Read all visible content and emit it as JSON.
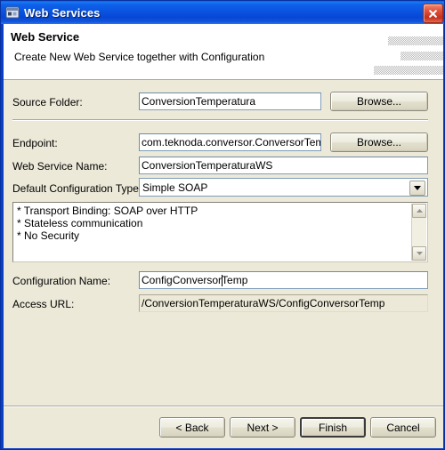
{
  "window": {
    "title": "Web Services",
    "icon": "app-window-icon",
    "close_label": "Close"
  },
  "banner": {
    "title": "Web Service",
    "subtitle": "Create New Web Service together with Configuration"
  },
  "form": {
    "source_folder": {
      "label": "Source Folder:",
      "value": "ConversionTemperatura",
      "browse_label": "Browse..."
    },
    "endpoint": {
      "label": "Endpoint:",
      "value": "com.teknoda.conversor.ConversorTemperatura",
      "browse_label": "Browse..."
    },
    "web_service_name": {
      "label": "Web Service Name:",
      "value": "ConversionTemperaturaWS"
    },
    "default_configuration_type": {
      "label": "Default Configuration Type:",
      "value": "Simple SOAP",
      "arrow_icon": "chevron-down-icon"
    },
    "description": {
      "lines": [
        "* Transport Binding: SOAP over HTTP",
        "* Stateless communication",
        "* No Security"
      ],
      "scroll_up_icon": "chevron-up-icon",
      "scroll_down_icon": "chevron-down-icon"
    },
    "configuration_name": {
      "label": "Configuration Name:",
      "value_before_caret": "ConfigConversor",
      "value_after_caret": "Temp"
    },
    "access_url": {
      "label": "Access URL:",
      "value": "/ConversionTemperaturaWS/ConfigConversorTemp"
    }
  },
  "footer": {
    "back_label": "< Back",
    "next_label": "Next >",
    "finish_label": "Finish",
    "cancel_label": "Cancel"
  },
  "colors": {
    "dialog_bg": "#ece9d8",
    "title_blue": "#0a53e0",
    "field_border": "#7f9db9",
    "close_red": "#c5301c"
  }
}
